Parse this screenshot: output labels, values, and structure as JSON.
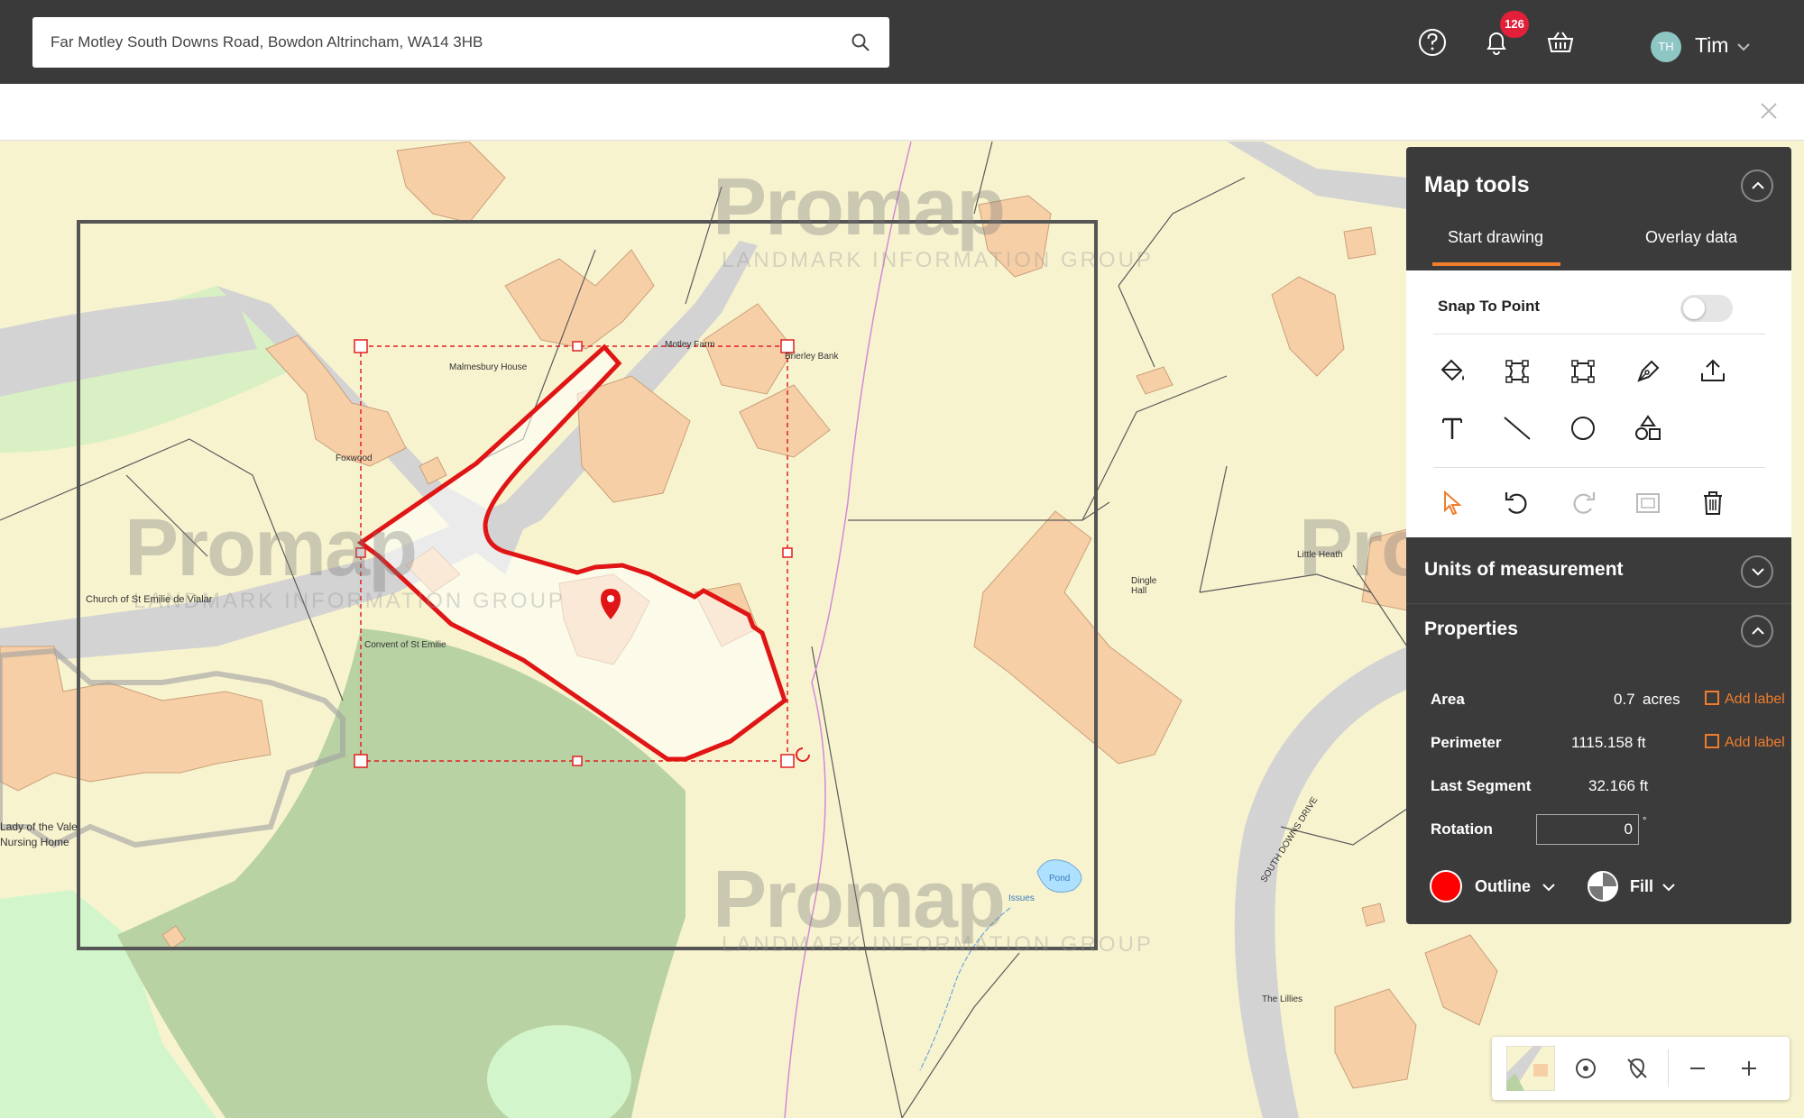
{
  "search": {
    "value": "Far Motley South Downs Road, Bowdon Altrincham, WA14 3HB"
  },
  "header": {
    "notification_count": "126",
    "user_initials": "TH",
    "user_name": "Tim"
  },
  "map": {
    "watermark": "Promap",
    "watermark_sub": "LANDMARK INFORMATION GROUP",
    "labels": {
      "church": "Church of St Emilie de Vialar",
      "convent": "Convent of St Emilie",
      "malmesbury": "Malmesbury House",
      "foxwood": "Foxwood",
      "motley_farm": "Motley Farm",
      "brierley": "Brierley Bank",
      "nursing_home_1": "Lady of the Vale",
      "nursing_home_2": "Nursing Home",
      "pond": "Pond",
      "issues": "Issues",
      "dingle": "Dingle Hall",
      "little_heath": "Little Heath",
      "south_downs": "SOUTH DOWNS DRIVE",
      "lillies": "The Lillies"
    }
  },
  "panel": {
    "title": "Map tools",
    "tabs": [
      "Start drawing",
      "Overlay data"
    ],
    "snap_label": "Snap To Point",
    "units_title": "Units of measurement",
    "properties_title": "Properties",
    "properties": {
      "area_label": "Area",
      "area_value": "0.7",
      "area_unit": "acres",
      "perimeter_label": "Perimeter",
      "perimeter_value": "1115.158 ft",
      "last_segment_label": "Last Segment",
      "last_segment_value": "32.166 ft",
      "rotation_label": "Rotation",
      "rotation_value": "0",
      "add_label": "Add label"
    },
    "outline_label": "Outline",
    "fill_label": "Fill",
    "colors": {
      "outline": "#ff0000",
      "accent": "#f07d2c"
    }
  }
}
